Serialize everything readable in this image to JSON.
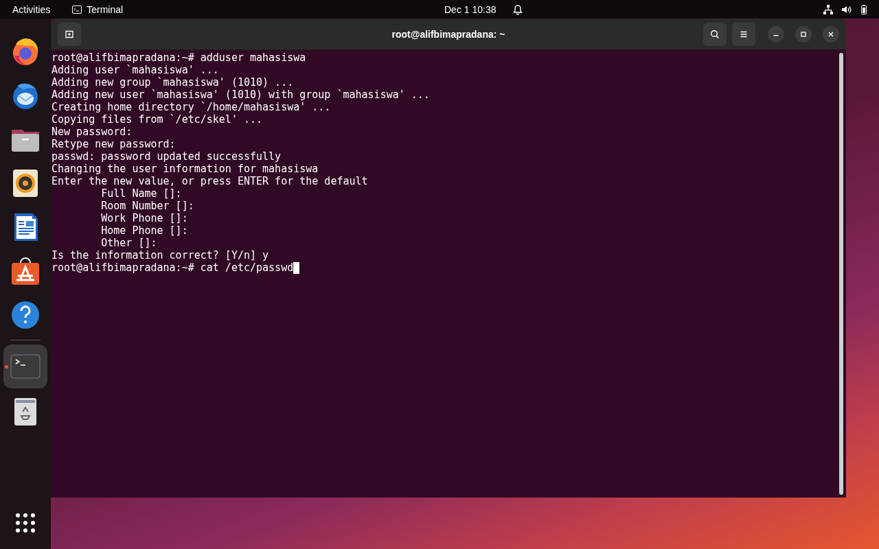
{
  "top_bar": {
    "activities": "Activities",
    "app_menu": "Terminal",
    "clock": "Dec 1  10:38"
  },
  "dock": {
    "items": [
      {
        "kind": "firefox",
        "running": false
      },
      {
        "kind": "thunderbird",
        "running": false
      },
      {
        "kind": "files",
        "running": false
      },
      {
        "kind": "rhythmbox",
        "running": false
      },
      {
        "kind": "writer",
        "running": false
      },
      {
        "kind": "software",
        "running": false
      },
      {
        "kind": "help",
        "running": false
      },
      {
        "kind": "terminal",
        "running": true
      },
      {
        "kind": "trash",
        "running": false
      }
    ]
  },
  "window": {
    "title": "root@alifbimapradana: ~"
  },
  "terminal": {
    "lines": [
      {
        "text": "root@alifbimapradana:~# adduser mahasiswa",
        "cursor": false
      },
      {
        "text": "Adding user `mahasiswa' ...",
        "cursor": false
      },
      {
        "text": "Adding new group `mahasiswa' (1010) ...",
        "cursor": false
      },
      {
        "text": "Adding new user `mahasiswa' (1010) with group `mahasiswa' ...",
        "cursor": false
      },
      {
        "text": "Creating home directory `/home/mahasiswa' ...",
        "cursor": false
      },
      {
        "text": "Copying files from `/etc/skel' ...",
        "cursor": false
      },
      {
        "text": "New password:",
        "cursor": false
      },
      {
        "text": "Retype new password:",
        "cursor": false
      },
      {
        "text": "passwd: password updated successfully",
        "cursor": false
      },
      {
        "text": "Changing the user information for mahasiswa",
        "cursor": false
      },
      {
        "text": "Enter the new value, or press ENTER for the default",
        "cursor": false
      },
      {
        "text": "\tFull Name []:",
        "cursor": false
      },
      {
        "text": "\tRoom Number []:",
        "cursor": false
      },
      {
        "text": "\tWork Phone []:",
        "cursor": false
      },
      {
        "text": "\tHome Phone []:",
        "cursor": false
      },
      {
        "text": "\tOther []:",
        "cursor": false
      },
      {
        "text": "Is the information correct? [Y/n] y",
        "cursor": false
      },
      {
        "text": "root@alifbimapradana:~# cat /etc/passwd",
        "cursor": true
      }
    ]
  }
}
